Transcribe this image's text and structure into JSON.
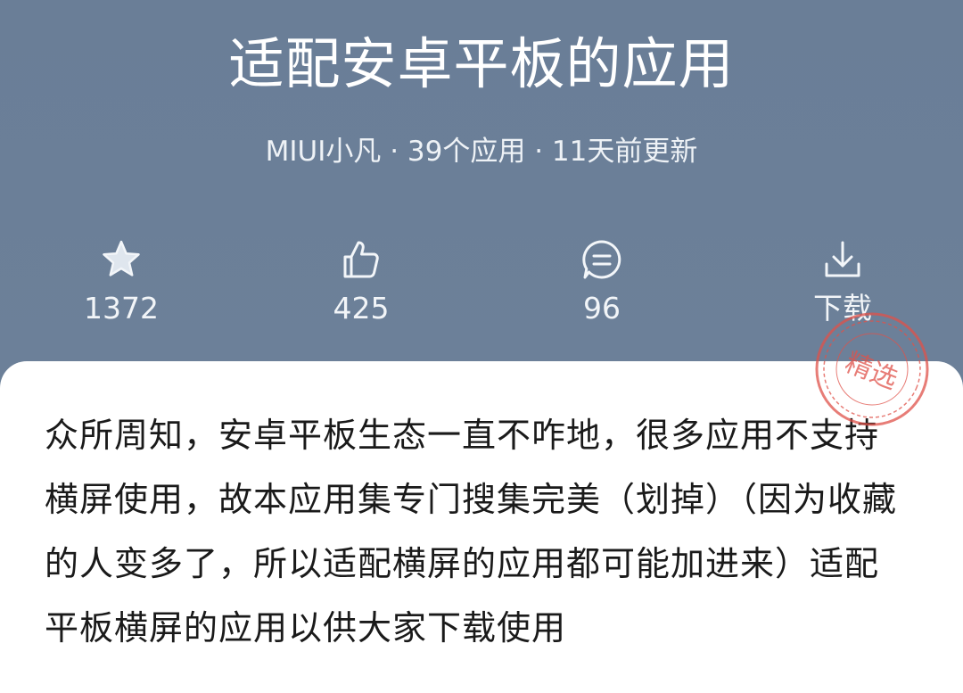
{
  "header": {
    "title": "适配安卓平板的应用",
    "meta": "MIUI小凡 · 39个应用 · 11天前更新"
  },
  "stats": [
    {
      "icon": "star-icon",
      "value": "1372"
    },
    {
      "icon": "thumbs-up-icon",
      "value": "425"
    },
    {
      "icon": "comment-icon",
      "value": "96"
    },
    {
      "icon": "download-icon",
      "value": "下载"
    }
  ],
  "stamp": {
    "label": "精选",
    "color": "#e0524a"
  },
  "description": "众所周知，安卓平板生态一直不咋地，很多应用不支持横屏使用，故本应用集专门搜集完美（划掉）（因为收藏的人变多了，所以适配横屏的应用都可能加进来）适配平板横屏的应用以供大家下载使用",
  "colors": {
    "header_bg": "#6b8098",
    "card_bg": "#ffffff",
    "text_dark": "#1a1a1a",
    "text_light": "#ffffff"
  }
}
